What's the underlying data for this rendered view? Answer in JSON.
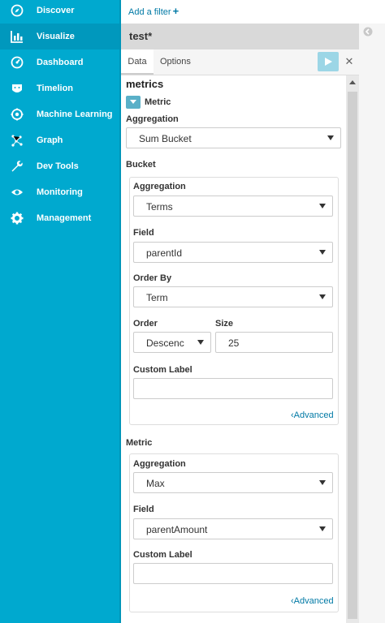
{
  "nav": {
    "items": [
      {
        "label": "Discover",
        "icon": "compass-icon"
      },
      {
        "label": "Visualize",
        "icon": "bar-chart-icon"
      },
      {
        "label": "Dashboard",
        "icon": "dashboard-icon"
      },
      {
        "label": "Timelion",
        "icon": "timelion-icon"
      },
      {
        "label": "Machine Learning",
        "icon": "machine-learning-icon"
      },
      {
        "label": "Graph",
        "icon": "graph-icon"
      },
      {
        "label": "Dev Tools",
        "icon": "wrench-icon"
      },
      {
        "label": "Monitoring",
        "icon": "eye-icon"
      },
      {
        "label": "Management",
        "icon": "gear-icon"
      }
    ],
    "active": "Visualize"
  },
  "filterbar": {
    "add_filter": "Add a filter"
  },
  "editor": {
    "title": "test*",
    "tabs": {
      "data": "Data",
      "options": "Options"
    },
    "metrics_heading": "metrics",
    "metric_toggle_label": "Metric",
    "aggregation_label": "Aggregation",
    "aggregation_value": "Sum Bucket",
    "bucket": {
      "heading": "Bucket",
      "aggregation_label": "Aggregation",
      "aggregation_value": "Terms",
      "field_label": "Field",
      "field_value": "parentId",
      "order_by_label": "Order By",
      "order_by_value": "Term",
      "order_label": "Order",
      "order_value": "Descenc",
      "size_label": "Size",
      "size_value": "25",
      "custom_label_label": "Custom Label",
      "custom_label_value": "",
      "advanced": "Advanced"
    },
    "metric": {
      "heading": "Metric",
      "aggregation_label": "Aggregation",
      "aggregation_value": "Max",
      "field_label": "Field",
      "field_value": "parentAmount",
      "custom_label_label": "Custom Label",
      "custom_label_value": "",
      "advanced": "Advanced"
    }
  },
  "colors": {
    "sidebar": "#00a9cf",
    "sidebar_active": "#0098bd",
    "link": "#0079a5",
    "apply": "#9cd6e6"
  }
}
